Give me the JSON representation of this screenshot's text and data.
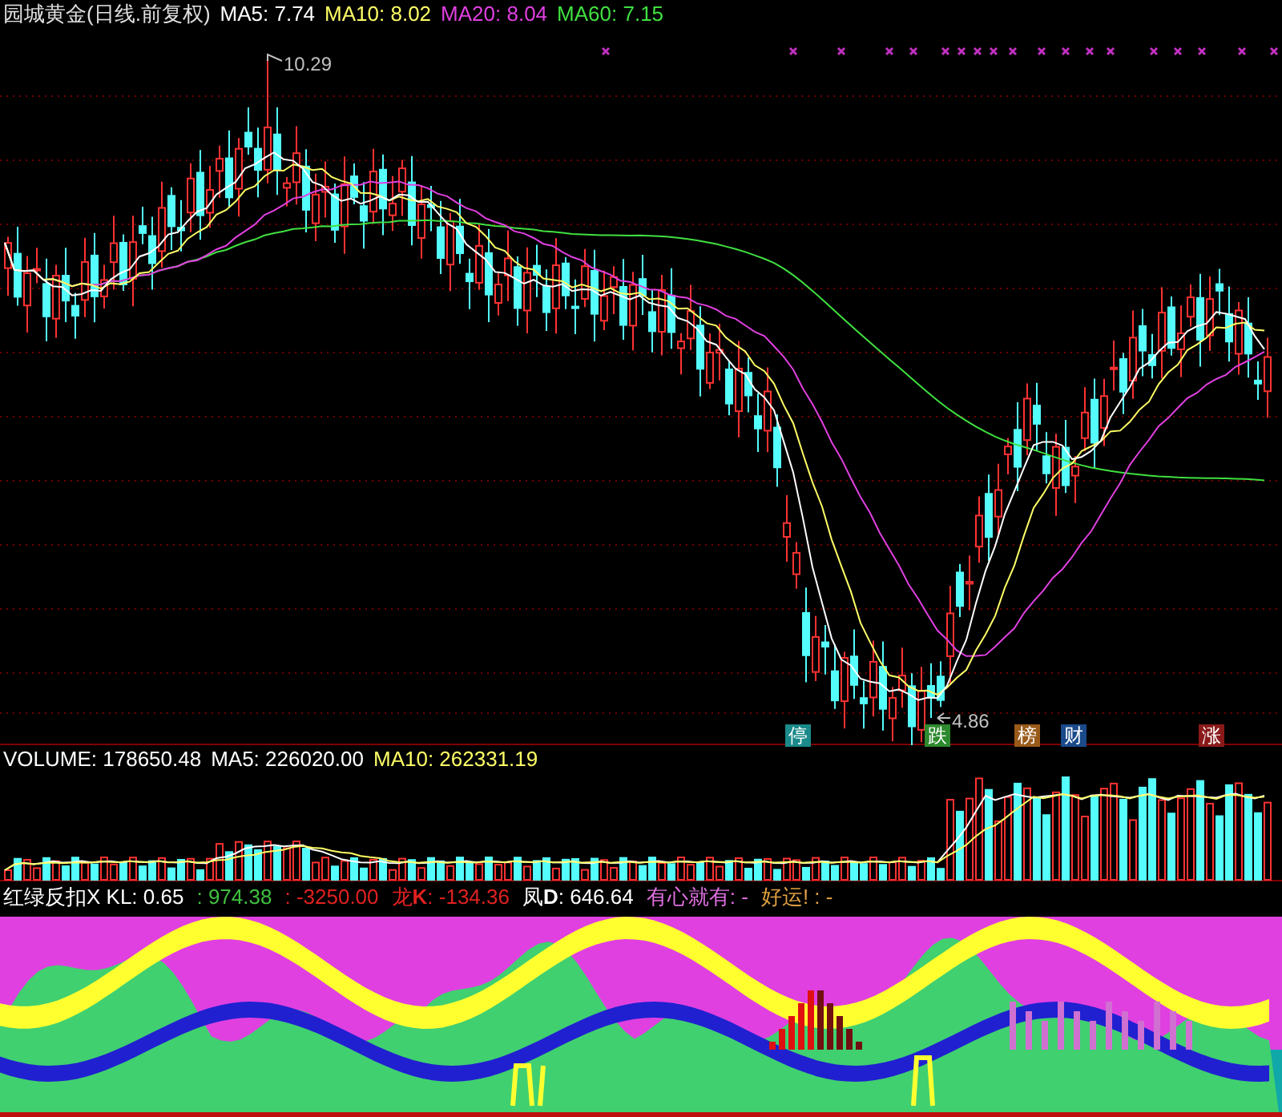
{
  "main_chart": {
    "title": "园城黄金(日线.前复权)",
    "indicators": [
      {
        "label": "MA5: 7.74",
        "color": "#ffffff"
      },
      {
        "label": "MA10: 8.02",
        "color": "#ffff66"
      },
      {
        "label": "MA20: 8.04",
        "color": "#e040e0"
      },
      {
        "label": "MA60: 7.15",
        "color": "#40e040"
      }
    ],
    "high_label": "10.29",
    "low_label": "4.86",
    "badges": [
      {
        "text": "停",
        "color": "#1a8a8a"
      },
      {
        "text": "跌",
        "color": "#2e8a2e"
      },
      {
        "text": "榜",
        "color": "#9a5a1a"
      },
      {
        "text": "财",
        "color": "#1a4a8a"
      },
      {
        "text": "涨",
        "color": "#8a1a1a"
      }
    ]
  },
  "volume_chart": {
    "indicators": [
      {
        "label": "VOLUME: 178650.48",
        "color": "#ffffff"
      },
      {
        "label": "MA5: 226020.00",
        "color": "#ffffff"
      },
      {
        "label": "MA10: 262331.19",
        "color": "#ffff66"
      }
    ]
  },
  "indicator_chart": {
    "indicators": [
      {
        "label": "红绿反扣X KL: 0.65",
        "color": "#ffffff"
      },
      {
        "label": ": 974.38",
        "color": "#40c040"
      },
      {
        "label": ": -3250.00",
        "color": "#e02020"
      },
      {
        "label": "龙**K**: -134.36",
        "color": "#e02020"
      },
      {
        "label": "凤**D**: 646.64",
        "color": "#ffffff"
      },
      {
        "label": "有心就有: -",
        "color": "#e070e0"
      },
      {
        "label": "好运! : -",
        "color": "#e0a040"
      }
    ]
  }
}
